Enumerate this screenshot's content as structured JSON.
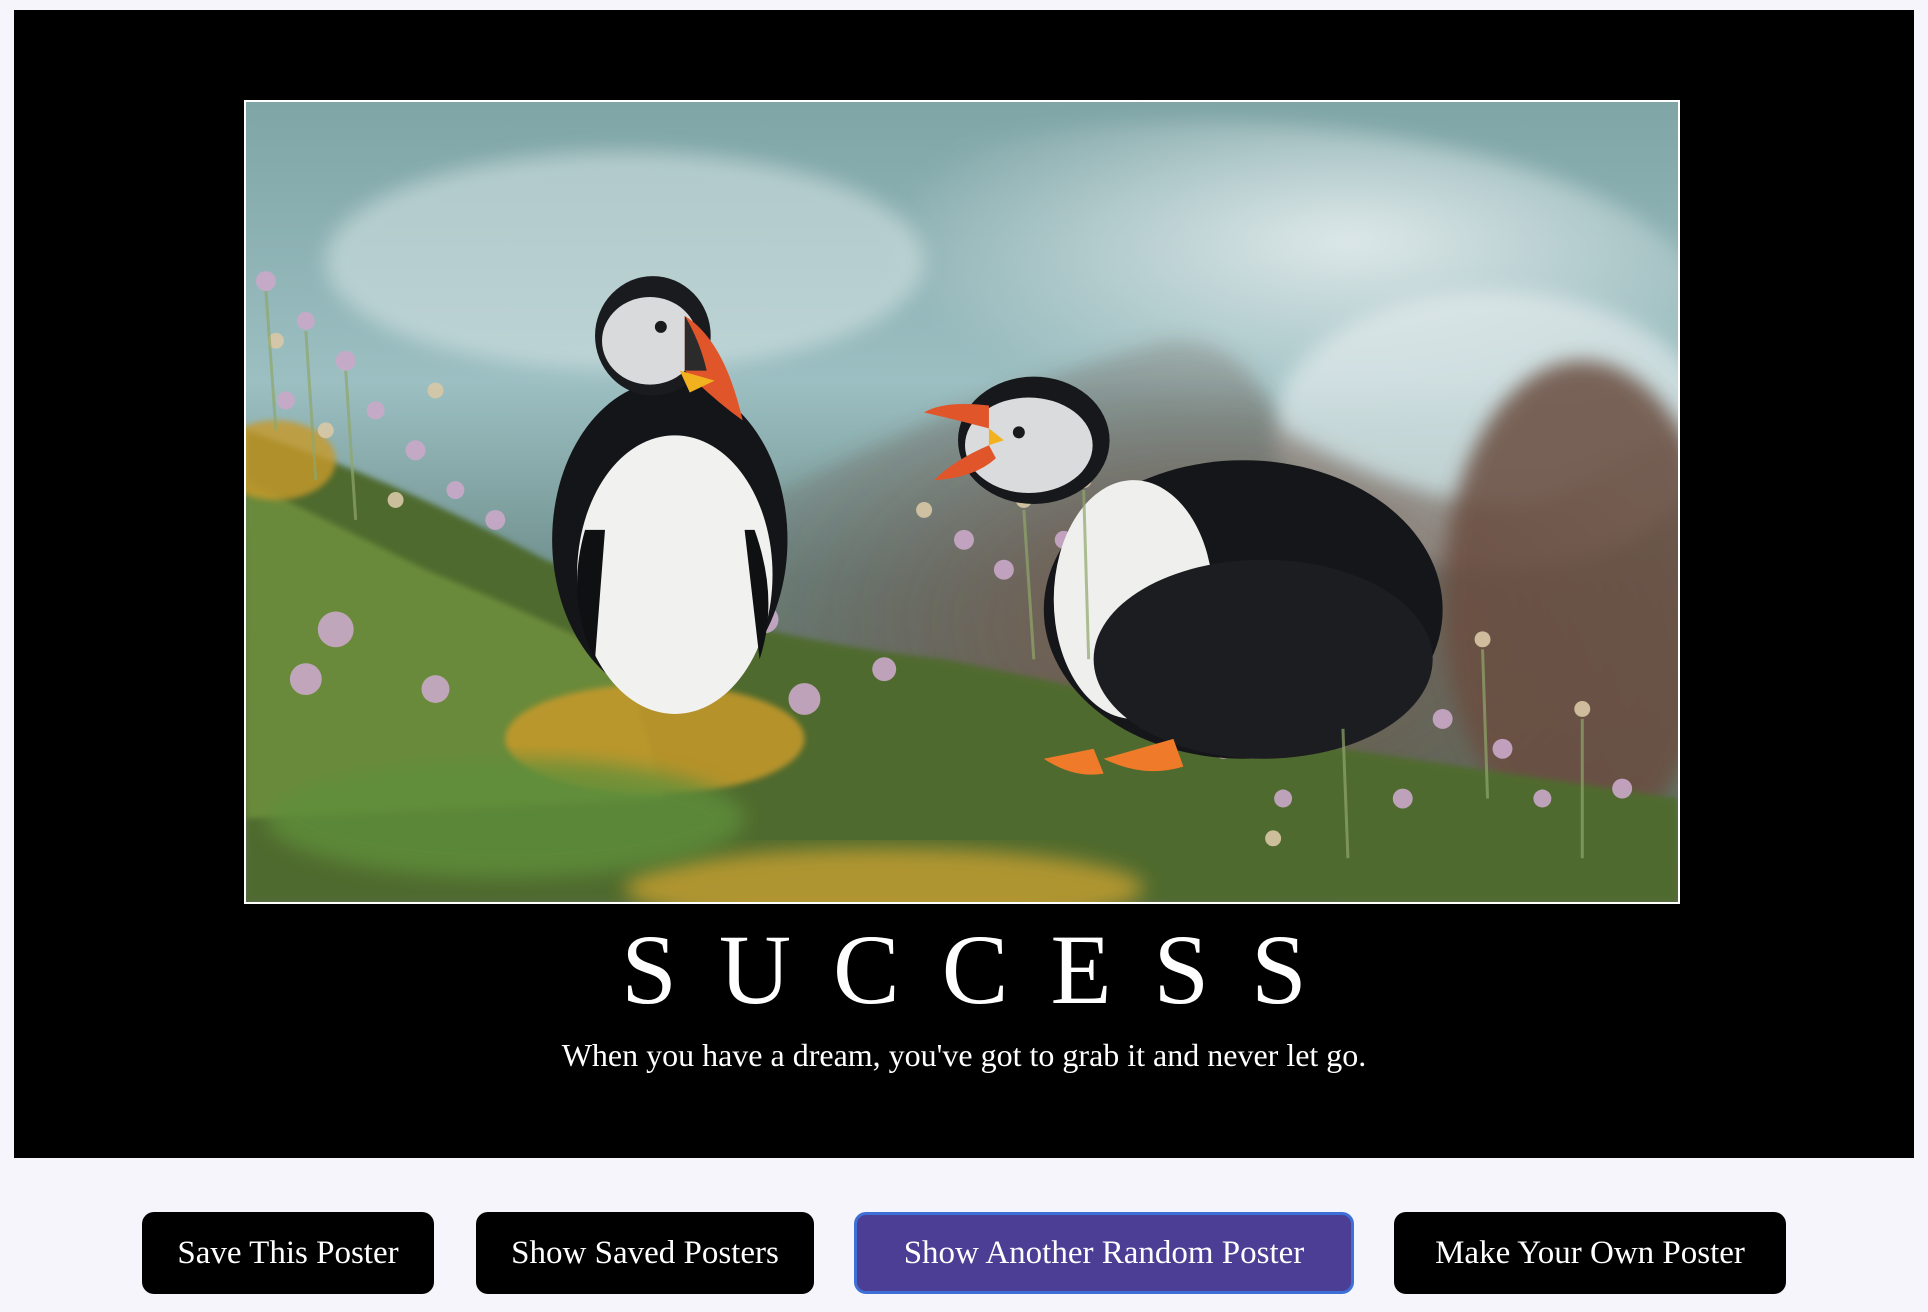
{
  "poster": {
    "title": "SUCCESS",
    "quote": "When you have a dream, you've got to grab it and never let go.",
    "image_alt": "Two puffins standing among pink sea thrift flowers on a cliff edge"
  },
  "buttons": {
    "save": "Save This Poster",
    "show_saved": "Show Saved Posters",
    "random": "Show Another Random Poster",
    "make_own": "Make Your Own Poster"
  },
  "colors": {
    "poster_background": "#000000",
    "page_background": "#f6f5fb",
    "button_background": "#000000",
    "active_button_background": "#4b3e94",
    "active_button_border": "#3d6fd6"
  }
}
